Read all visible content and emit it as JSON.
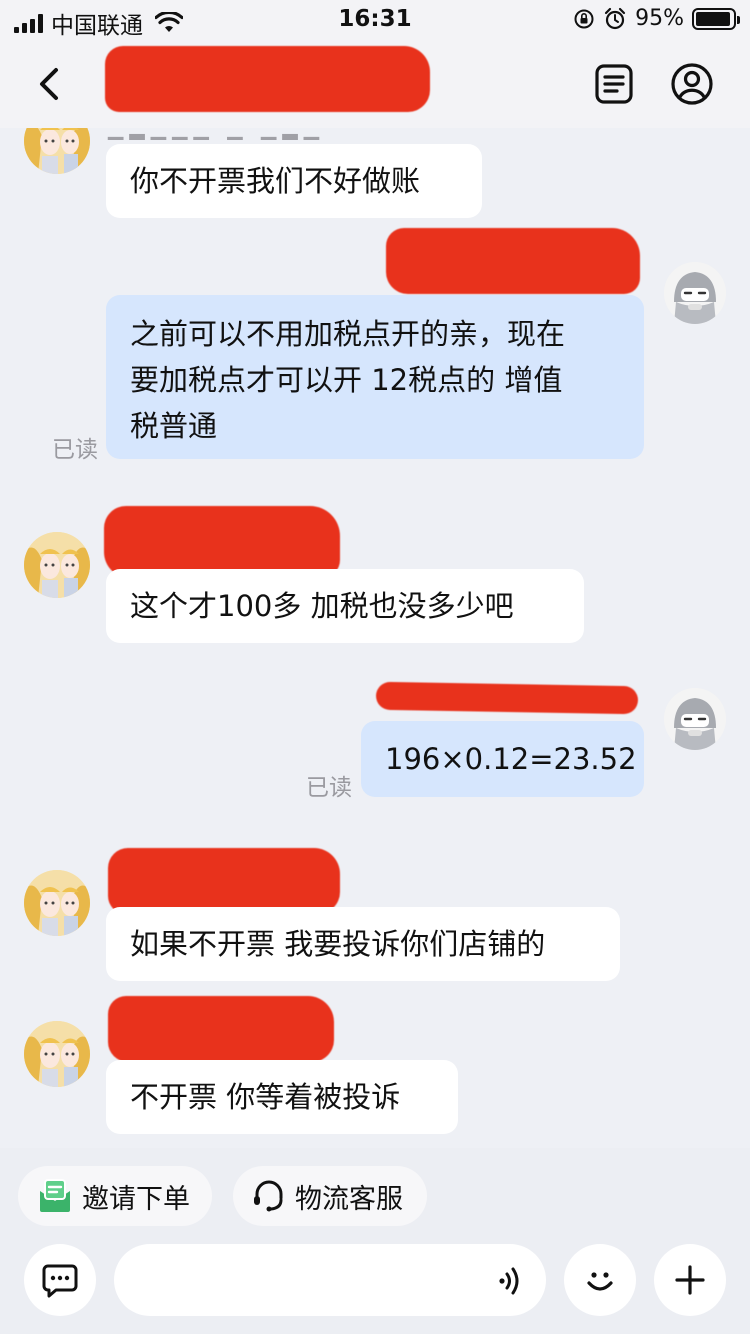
{
  "status_bar": {
    "carrier": "中国联通",
    "time": "16:31",
    "battery": "95%",
    "battery_level": 0.95
  },
  "nav": {
    "title": "",
    "back_icon": "chevron-left-icon",
    "orders_icon": "order-list-icon",
    "profile_icon": "profile-icon"
  },
  "messages": [
    {
      "side": "left",
      "text": "你不开票我们不好做账"
    },
    {
      "side": "right",
      "lines": [
        "之前可以不用加税点开的亲，现在",
        "要加税点才可以开 12税点的  增值",
        "税普通"
      ],
      "read": "已读"
    },
    {
      "side": "left",
      "text": "这个才100多 加税也没多少吧"
    },
    {
      "side": "right",
      "text": "196×0.12=23.52",
      "read": "已读"
    },
    {
      "side": "left",
      "text": "如果不开票 我要投诉你们店铺的"
    },
    {
      "side": "left",
      "text": "不开票 你等着被投诉"
    }
  ],
  "quick_actions": [
    {
      "label": "邀请下单",
      "icon": "invite-order-icon",
      "color": "#3bb36a"
    },
    {
      "label": "物流客服",
      "icon": "headset-icon"
    }
  ],
  "input": {
    "placeholder": "",
    "value": ""
  },
  "colors": {
    "background": "#eef0f5",
    "own_bubble": "#d6e6fd",
    "other_bubble": "#ffffff",
    "redaction": "#e8321c",
    "read_text": "#9a9aa0"
  }
}
